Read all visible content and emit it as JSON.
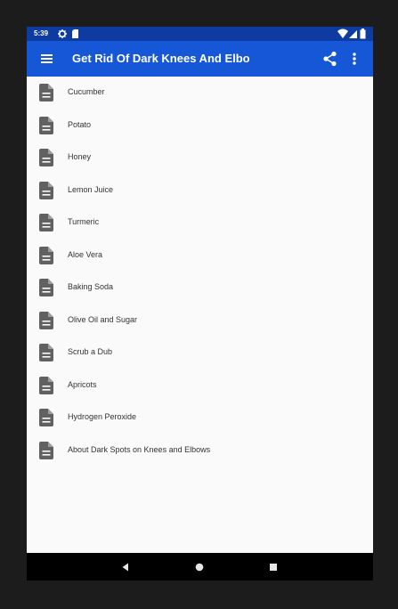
{
  "status_bar": {
    "time": "5:39",
    "icons": [
      "settings-icon",
      "sd-card-icon",
      "wifi-icon",
      "signal-icon",
      "battery-icon"
    ]
  },
  "app_bar": {
    "title": "Get Rid Of Dark Knees And Elbo",
    "icons": [
      "menu-icon",
      "share-icon",
      "more-vert-icon"
    ]
  },
  "list": {
    "item_icon": "document-icon",
    "items": [
      {
        "label": "Cucumber"
      },
      {
        "label": "Potato"
      },
      {
        "label": "Honey"
      },
      {
        "label": "Lemon Juice"
      },
      {
        "label": "Turmeric"
      },
      {
        "label": "Aloe Vera"
      },
      {
        "label": "Baking Soda"
      },
      {
        "label": "Olive Oil and Sugar"
      },
      {
        "label": "Scrub a Dub"
      },
      {
        "label": "Apricots"
      },
      {
        "label": "Hydrogen Peroxide"
      },
      {
        "label": "About Dark Spots on Knees and Elbows"
      }
    ]
  },
  "nav_bar": {
    "icons": [
      "back-icon",
      "home-icon",
      "recents-icon"
    ]
  },
  "colors": {
    "status_bar": "#0d3ba0",
    "app_bar": "#1557d6",
    "list_background": "#fafafa",
    "icon_gray": "#616161",
    "nav_bar": "#000000"
  }
}
